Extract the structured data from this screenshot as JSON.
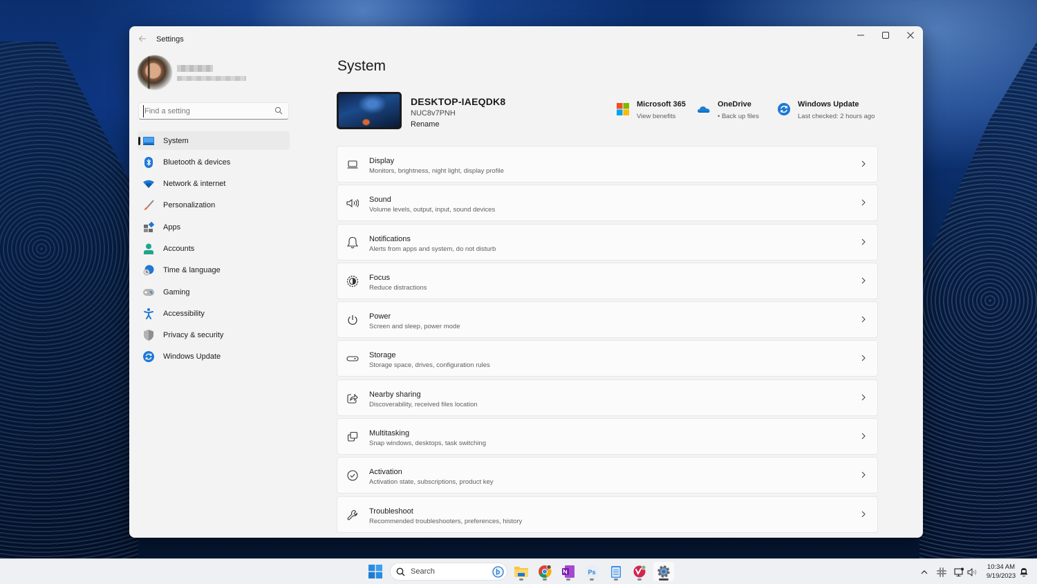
{
  "window": {
    "app_title": "Settings",
    "controls": {
      "minimize": "minimize",
      "maximize": "maximize",
      "close": "close"
    }
  },
  "profile": {
    "name": "(blurred)",
    "email": "(blurred)"
  },
  "search": {
    "placeholder": "Find a setting",
    "value": ""
  },
  "sidebar": {
    "items": [
      {
        "label": "System",
        "icon": "system-monitor-icon",
        "active": true
      },
      {
        "label": "Bluetooth & devices",
        "icon": "bluetooth-icon",
        "active": false
      },
      {
        "label": "Network & internet",
        "icon": "wifi-icon",
        "active": false
      },
      {
        "label": "Personalization",
        "icon": "paintbrush-icon",
        "active": false
      },
      {
        "label": "Apps",
        "icon": "apps-icon",
        "active": false
      },
      {
        "label": "Accounts",
        "icon": "person-icon",
        "active": false
      },
      {
        "label": "Time & language",
        "icon": "globe-clock-icon",
        "active": false
      },
      {
        "label": "Gaming",
        "icon": "gamepad-icon",
        "active": false
      },
      {
        "label": "Accessibility",
        "icon": "accessibility-icon",
        "active": false
      },
      {
        "label": "Privacy & security",
        "icon": "shield-icon",
        "active": false
      },
      {
        "label": "Windows Update",
        "icon": "update-icon",
        "active": false
      }
    ]
  },
  "main": {
    "title": "System",
    "device": {
      "name": "DESKTOP-IAEQDK8",
      "model": "NUC8v7PNH",
      "rename_label": "Rename"
    },
    "quick_links": [
      {
        "title": "Microsoft 365",
        "subtitle": "View benefits",
        "icon": "microsoft-logo-icon"
      },
      {
        "title": "OneDrive",
        "subtitle": "• Back up files",
        "icon": "onedrive-cloud-icon"
      },
      {
        "title": "Windows Update",
        "subtitle": "Last checked: 2 hours ago",
        "icon": "update-icon"
      }
    ],
    "cards": [
      {
        "title": "Display",
        "subtitle": "Monitors, brightness, night light, display profile",
        "icon": "laptop-icon"
      },
      {
        "title": "Sound",
        "subtitle": "Volume levels, output, input, sound devices",
        "icon": "speaker-icon"
      },
      {
        "title": "Notifications",
        "subtitle": "Alerts from apps and system, do not disturb",
        "icon": "bell-icon"
      },
      {
        "title": "Focus",
        "subtitle": "Reduce distractions",
        "icon": "focus-icon"
      },
      {
        "title": "Power",
        "subtitle": "Screen and sleep, power mode",
        "icon": "power-icon"
      },
      {
        "title": "Storage",
        "subtitle": "Storage space, drives, configuration rules",
        "icon": "storage-drive-icon"
      },
      {
        "title": "Nearby sharing",
        "subtitle": "Discoverability, received files location",
        "icon": "share-icon"
      },
      {
        "title": "Multitasking",
        "subtitle": "Snap windows, desktops, task switching",
        "icon": "multitasking-icon"
      },
      {
        "title": "Activation",
        "subtitle": "Activation state, subscriptions, product key",
        "icon": "checkmark-circle-icon"
      },
      {
        "title": "Troubleshoot",
        "subtitle": "Recommended troubleshooters, preferences, history",
        "icon": "wrench-icon"
      }
    ]
  },
  "taskbar": {
    "search_label": "Search",
    "apps": [
      {
        "name": "File Explorer",
        "icon": "folder-icon"
      },
      {
        "name": "Google Chrome",
        "icon": "chrome-icon"
      },
      {
        "name": "OneNote",
        "icon": "onenote-icon"
      },
      {
        "name": "Photoshop",
        "icon": "photoshop-icon",
        "label": "Ps"
      },
      {
        "name": "Notepad",
        "icon": "notepad-icon"
      },
      {
        "name": "Vivaldi",
        "icon": "vivaldi-icon"
      },
      {
        "name": "Settings",
        "icon": "settings-gear-icon",
        "active": true
      }
    ],
    "tray": {
      "time": "10:34 AM",
      "date": "9/19/2023"
    }
  },
  "colors": {
    "accent": "#0067c0",
    "window_bg": "#f3f3f3",
    "card_bg": "#fbfbfb"
  }
}
